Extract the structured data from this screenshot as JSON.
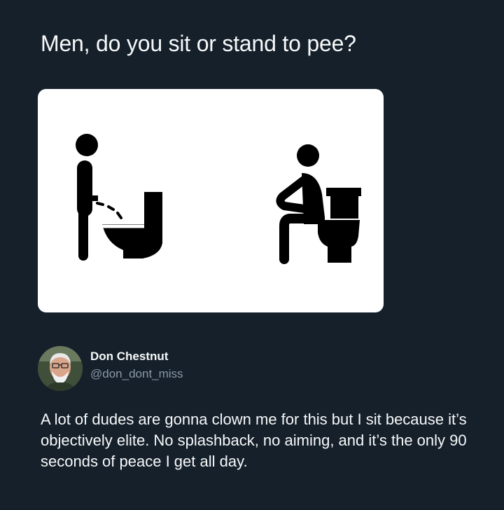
{
  "post": {
    "question": "Men, do you sit or stand to pee?",
    "body": "A lot of dudes are gonna clown me for this but I sit because it’s objectively elite. No splashback, no aiming, and it’s the only 90 seconds of peace I get all day."
  },
  "author": {
    "name": "Don Chestnut",
    "handle": "@don_dont_miss"
  },
  "image": {
    "icons": [
      "standing-man-at-toilet-icon",
      "sitting-man-on-toilet-icon"
    ]
  },
  "colors": {
    "background": "#15202b",
    "text": "#f7f9f9",
    "secondary_text": "#8b98a5",
    "card": "#ffffff",
    "pictogram": "#000000"
  }
}
